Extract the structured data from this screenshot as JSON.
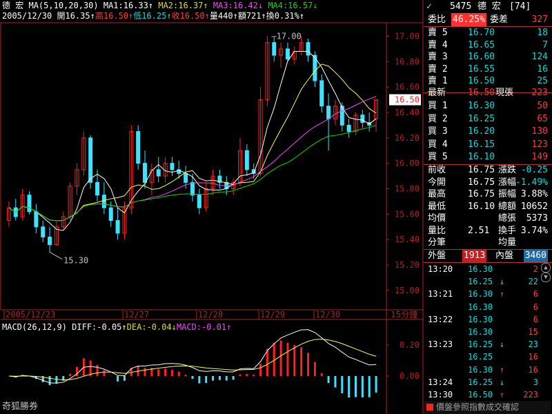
{
  "header": {
    "name": "德  宏",
    "ma_label": "MA(5,10,20,30)",
    "ma1": "MA1:16.33↑",
    "ma2": "MA2:16.37↑",
    "ma3": "MA3:16.42↓",
    "ma4": "MA4:16.57↓",
    "date": "2005/12/30",
    "open": "開16.35↑",
    "high": "高16.50↑",
    "low": "低16.25↑",
    "close": "收16.50↑",
    "volume": "量440↑",
    "amount": "額721↑",
    "turnover": "換0.31%↑"
  },
  "chart_data": {
    "type": "candlestick",
    "interval_label": "15分鐘",
    "y_ticks": [
      "17.00",
      "16.80",
      "16.60",
      "16.40",
      "16.20",
      "16.00",
      "15.80",
      "15.60",
      "15.40",
      "15.20",
      "15.00"
    ],
    "ylim": [
      14.88,
      17.1
    ],
    "current_price": "16.50",
    "x_labels": [
      "2005/12/23",
      "12/27",
      "12/28",
      "12/29",
      "12/30"
    ],
    "annotations": {
      "max": "17.00",
      "min": "15.30"
    },
    "candles": [
      [
        15.55,
        15.7,
        15.5,
        15.65
      ],
      [
        15.65,
        15.72,
        15.55,
        15.58
      ],
      [
        15.58,
        15.8,
        15.55,
        15.75
      ],
      [
        15.75,
        15.78,
        15.6,
        15.62
      ],
      [
        15.62,
        15.68,
        15.45,
        15.5
      ],
      [
        15.5,
        15.55,
        15.38,
        15.42
      ],
      [
        15.42,
        15.5,
        15.3,
        15.36
      ],
      [
        15.36,
        15.55,
        15.35,
        15.5
      ],
      [
        15.5,
        15.62,
        15.48,
        15.58
      ],
      [
        15.58,
        15.85,
        15.55,
        15.82
      ],
      [
        15.82,
        16.0,
        15.75,
        15.95
      ],
      [
        15.95,
        16.25,
        15.9,
        16.2
      ],
      [
        16.2,
        16.22,
        15.8,
        15.85
      ],
      [
        15.85,
        15.95,
        15.7,
        15.75
      ],
      [
        15.75,
        15.85,
        15.6,
        15.65
      ],
      [
        15.65,
        15.7,
        15.5,
        15.55
      ],
      [
        15.55,
        15.65,
        15.4,
        15.45
      ],
      [
        15.45,
        15.7,
        15.4,
        15.65
      ],
      [
        15.65,
        16.3,
        15.6,
        16.25
      ],
      [
        16.25,
        16.3,
        15.95,
        16.0
      ],
      [
        16.0,
        16.1,
        15.8,
        15.85
      ],
      [
        15.85,
        16.0,
        15.75,
        15.95
      ],
      [
        15.95,
        16.05,
        15.85,
        15.9
      ],
      [
        15.9,
        16.05,
        15.85,
        16.0
      ],
      [
        16.0,
        16.05,
        15.9,
        15.95
      ],
      [
        15.95,
        16.02,
        15.88,
        15.92
      ],
      [
        15.92,
        15.98,
        15.8,
        15.85
      ],
      [
        15.85,
        15.92,
        15.7,
        15.75
      ],
      [
        15.75,
        15.8,
        15.6,
        15.65
      ],
      [
        15.65,
        15.85,
        15.62,
        15.8
      ],
      [
        15.8,
        15.95,
        15.75,
        15.9
      ],
      [
        15.9,
        15.95,
        15.8,
        15.85
      ],
      [
        15.85,
        15.9,
        15.75,
        15.8
      ],
      [
        15.8,
        15.88,
        15.75,
        15.85
      ],
      [
        15.85,
        16.2,
        15.82,
        16.1
      ],
      [
        16.1,
        16.15,
        15.9,
        15.95
      ],
      [
        15.95,
        16.0,
        15.88,
        15.92
      ],
      [
        15.92,
        16.6,
        15.9,
        16.5
      ],
      [
        16.5,
        17.0,
        16.45,
        16.95
      ],
      [
        16.95,
        17.0,
        16.8,
        16.85
      ],
      [
        16.85,
        16.95,
        16.75,
        16.9
      ],
      [
        16.9,
        16.95,
        16.8,
        16.82
      ],
      [
        16.82,
        16.92,
        16.78,
        16.88
      ],
      [
        16.88,
        17.0,
        16.85,
        16.95
      ],
      [
        16.95,
        16.98,
        16.8,
        16.85
      ],
      [
        16.85,
        16.88,
        16.6,
        16.65
      ],
      [
        16.65,
        16.7,
        16.4,
        16.45
      ],
      [
        16.45,
        16.55,
        16.1,
        16.35
      ],
      [
        16.35,
        16.5,
        16.3,
        16.45
      ],
      [
        16.45,
        16.48,
        16.25,
        16.3
      ],
      [
        16.3,
        16.35,
        16.2,
        16.25
      ],
      [
        16.25,
        16.4,
        16.22,
        16.38
      ],
      [
        16.38,
        16.42,
        16.28,
        16.32
      ],
      [
        16.32,
        16.4,
        16.25,
        16.3
      ],
      [
        16.35,
        16.5,
        16.25,
        16.5
      ]
    ]
  },
  "macd": {
    "label": "MACD(26,12,9)",
    "diff": "DIFF:-0.05↑",
    "dea": "DEA:-0.04↓",
    "macd": "MACD:-0.01↑",
    "y_ticks": [
      "0.20",
      "0.00"
    ]
  },
  "watermark": "奇狐勝券",
  "panel": {
    "code": "5475",
    "name": "德  宏",
    "rank": "[74]",
    "bid_ratio_label": "委比",
    "bid_ratio": "46.25%",
    "bid_diff_label": "委差",
    "bid_diff": "327",
    "asks": [
      {
        "label": "賣 5",
        "price": "16.70",
        "vol": "18"
      },
      {
        "label": "賣 4",
        "price": "16.65",
        "vol": "7"
      },
      {
        "label": "賣 3",
        "price": "16.60",
        "vol": "124"
      },
      {
        "label": "賣 2",
        "price": "16.55",
        "vol": "16"
      },
      {
        "label": "賣 1",
        "price": "16.50",
        "vol": "25"
      }
    ],
    "last_label": "最新",
    "last_price": "16.50",
    "cur_vol_label": "現張",
    "cur_vol": "223",
    "bids": [
      {
        "label": "買 1",
        "price": "16.30",
        "vol": "50"
      },
      {
        "label": "買 2",
        "price": "16.25",
        "vol": "65"
      },
      {
        "label": "買 3",
        "price": "16.20",
        "vol": "130"
      },
      {
        "label": "買 4",
        "price": "16.15",
        "vol": "123"
      },
      {
        "label": "買 5",
        "price": "16.10",
        "vol": "149"
      }
    ],
    "stats": [
      {
        "l1": "前收",
        "v1": "16.75",
        "l2": "漲跌",
        "v2": "-0.25"
      },
      {
        "l1": "今開",
        "v1": "16.75",
        "l2": "漲幅",
        "v2": "-1.49%"
      },
      {
        "l1": "最高",
        "v1": "16.75",
        "l2": "振幅",
        "v2": "3.88%"
      },
      {
        "l1": "最低",
        "v1": "16.10",
        "l2": "總額",
        "v2": "10652"
      },
      {
        "l1": "均價",
        "v1": "",
        "l2": "總張",
        "v2": "5373"
      },
      {
        "l1": "量比",
        "v1": "2.51",
        "l2": "換手",
        "v2": "3.74%"
      },
      {
        "l1": "分筆",
        "v1": "",
        "l2": "均量",
        "v2": ""
      }
    ],
    "outer_label": "外盤",
    "outer": "1913",
    "inner_label": "內盤",
    "inner": "3460",
    "ticks": [
      {
        "time": "13:20",
        "price": "16.30",
        "arrow": "",
        "vol": "2",
        "color": "red"
      },
      {
        "time": "",
        "price": "16.25",
        "arrow": "↓",
        "vol": "22",
        "color": "cyan"
      },
      {
        "time": "13:21",
        "price": "16.30",
        "arrow": "↑",
        "vol": "6",
        "color": "red"
      },
      {
        "time": "",
        "price": "16.30",
        "arrow": "",
        "vol": "6",
        "color": "red"
      },
      {
        "time": "13:22",
        "price": "16.30",
        "arrow": "",
        "vol": "6",
        "color": "red"
      },
      {
        "time": "",
        "price": "16.30",
        "arrow": "",
        "vol": "15",
        "color": "red"
      },
      {
        "time": "13:23",
        "price": "16.25",
        "arrow": "↓",
        "vol": "23",
        "color": "cyan"
      },
      {
        "time": "",
        "price": "16.25",
        "arrow": "",
        "vol": "16",
        "color": "red"
      },
      {
        "time": "",
        "price": "16.30",
        "arrow": "↑",
        "vol": "16",
        "color": "red"
      },
      {
        "time": "13:24",
        "price": "16.25",
        "arrow": "↓",
        "vol": "3",
        "color": "cyan"
      },
      {
        "time": "13:30",
        "price": "16.50",
        "arrow": "↑",
        "vol": "223",
        "color": "red"
      }
    ],
    "status_text": "價盤參照指數成交確認"
  }
}
